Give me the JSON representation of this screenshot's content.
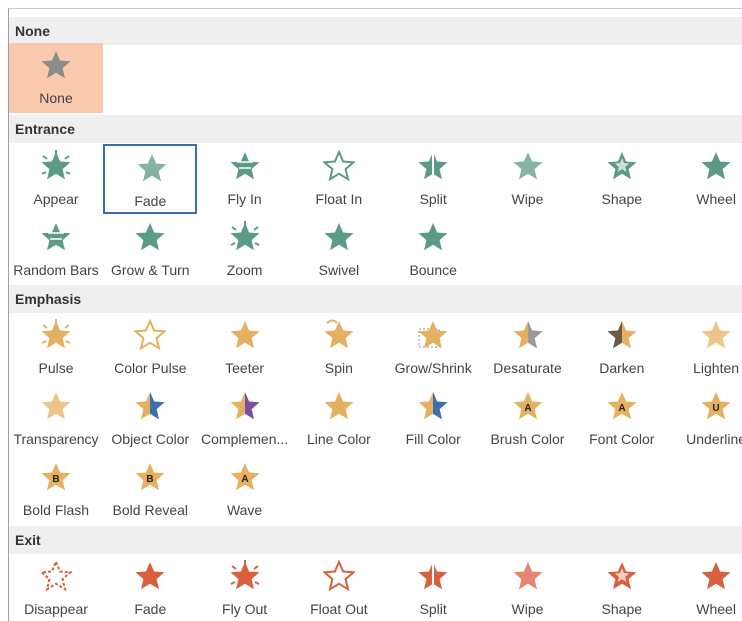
{
  "sections": {
    "none": "None",
    "entrance": "Entrance",
    "emphasis": "Emphasis",
    "exit": "Exit"
  },
  "colors": {
    "entrance": "#5b9a86",
    "emphasis": "#e5b160",
    "exit": "#d9603f",
    "none": "#8c8c8c",
    "selected_bg": "#f8c9ad",
    "focus_border": "#3b6db5"
  },
  "none_items": [
    {
      "label": "None",
      "icon": "star-gray-icon"
    }
  ],
  "entrance_items": [
    {
      "label": "Appear",
      "icon": "appear-icon"
    },
    {
      "label": "Fade",
      "icon": "fade-icon"
    },
    {
      "label": "Fly In",
      "icon": "fly-in-icon"
    },
    {
      "label": "Float In",
      "icon": "float-in-icon"
    },
    {
      "label": "Split",
      "icon": "split-icon"
    },
    {
      "label": "Wipe",
      "icon": "wipe-icon"
    },
    {
      "label": "Shape",
      "icon": "shape-icon"
    },
    {
      "label": "Wheel",
      "icon": "wheel-icon"
    },
    {
      "label": "Random Bars",
      "icon": "random-bars-icon"
    },
    {
      "label": "Grow & Turn",
      "icon": "grow-turn-icon"
    },
    {
      "label": "Zoom",
      "icon": "zoom-icon"
    },
    {
      "label": "Swivel",
      "icon": "swivel-icon"
    },
    {
      "label": "Bounce",
      "icon": "bounce-icon"
    }
  ],
  "emphasis_items": [
    {
      "label": "Pulse",
      "icon": "pulse-icon"
    },
    {
      "label": "Color Pulse",
      "icon": "color-pulse-icon"
    },
    {
      "label": "Teeter",
      "icon": "teeter-icon"
    },
    {
      "label": "Spin",
      "icon": "spin-icon"
    },
    {
      "label": "Grow/Shrink",
      "icon": "grow-shrink-icon"
    },
    {
      "label": "Desaturate",
      "icon": "desaturate-icon"
    },
    {
      "label": "Darken",
      "icon": "darken-icon"
    },
    {
      "label": "Lighten",
      "icon": "lighten-icon"
    },
    {
      "label": "Transparency",
      "icon": "transparency-icon"
    },
    {
      "label": "Object Color",
      "icon": "object-color-icon"
    },
    {
      "label": "Complemen...",
      "icon": "complementary-color-icon"
    },
    {
      "label": "Line Color",
      "icon": "line-color-icon"
    },
    {
      "label": "Fill Color",
      "icon": "fill-color-icon"
    },
    {
      "label": "Brush Color",
      "icon": "brush-color-icon",
      "letter": "A"
    },
    {
      "label": "Font Color",
      "icon": "font-color-icon",
      "letter": "A"
    },
    {
      "label": "Underline",
      "icon": "underline-icon",
      "letter": "U"
    },
    {
      "label": "Bold Flash",
      "icon": "bold-flash-icon",
      "letter": "B"
    },
    {
      "label": "Bold Reveal",
      "icon": "bold-reveal-icon",
      "letter": "B"
    },
    {
      "label": "Wave",
      "icon": "wave-icon",
      "letter": "A"
    }
  ],
  "exit_items": [
    {
      "label": "Disappear",
      "icon": "disappear-icon"
    },
    {
      "label": "Fade",
      "icon": "fade-out-icon"
    },
    {
      "label": "Fly Out",
      "icon": "fly-out-icon"
    },
    {
      "label": "Float Out",
      "icon": "float-out-icon"
    },
    {
      "label": "Split",
      "icon": "split-out-icon"
    },
    {
      "label": "Wipe",
      "icon": "wipe-out-icon"
    },
    {
      "label": "Shape",
      "icon": "shape-out-icon"
    },
    {
      "label": "Wheel",
      "icon": "wheel-out-icon"
    }
  ],
  "state": {
    "selected_none_index": 0,
    "focused_entrance_index": 1
  }
}
